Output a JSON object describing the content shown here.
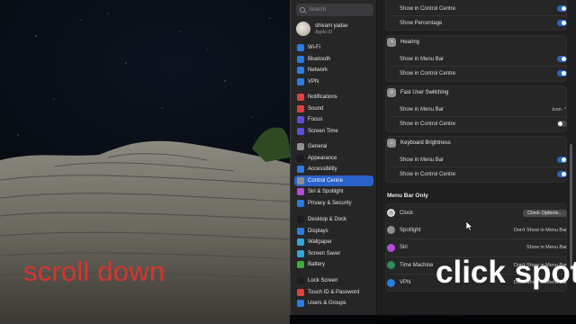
{
  "overlay": {
    "scroll_text": "scroll down",
    "click_text": "click spot"
  },
  "search": {
    "placeholder": "Search"
  },
  "account": {
    "name": "shivam yadav",
    "sub": "Apple ID"
  },
  "sidebar": {
    "network": [
      {
        "label": "Wi-Fi",
        "icon": "wifi-icon",
        "color": "#2a7de1"
      },
      {
        "label": "Bluetooth",
        "icon": "bluetooth-icon",
        "color": "#2a7de1"
      },
      {
        "label": "Network",
        "icon": "network-icon",
        "color": "#2a7de1"
      },
      {
        "label": "VPN",
        "icon": "vpn-icon",
        "color": "#2a7de1"
      }
    ],
    "notify": [
      {
        "label": "Notifications",
        "icon": "notifications-icon",
        "color": "#e0413c"
      },
      {
        "label": "Sound",
        "icon": "sound-icon",
        "color": "#e0413c"
      },
      {
        "label": "Focus",
        "icon": "focus-icon",
        "color": "#5b4fd6"
      },
      {
        "label": "Screen Time",
        "icon": "screen-time-icon",
        "color": "#5b4fd6"
      }
    ],
    "general": [
      {
        "label": "General",
        "icon": "gear-icon",
        "color": "#8e8e93"
      },
      {
        "label": "Appearance",
        "icon": "appearance-icon",
        "color": "#1c1c1e"
      },
      {
        "label": "Accessibility",
        "icon": "accessibility-icon",
        "color": "#2a7de1"
      },
      {
        "label": "Control Centre",
        "icon": "control-centre-icon",
        "color": "#8e8e93",
        "active": true
      },
      {
        "label": "Siri & Spotlight",
        "icon": "siri-icon",
        "color": "#b44ad6"
      },
      {
        "label": "Privacy & Security",
        "icon": "privacy-icon",
        "color": "#2a7de1"
      }
    ],
    "display": [
      {
        "label": "Desktop & Dock",
        "icon": "dock-icon",
        "color": "#1c1c1e"
      },
      {
        "label": "Displays",
        "icon": "displays-icon",
        "color": "#2a7de1"
      },
      {
        "label": "Wallpaper",
        "icon": "wallpaper-icon",
        "color": "#35a7d8"
      },
      {
        "label": "Screen Saver",
        "icon": "screen-saver-icon",
        "color": "#35a7d8"
      },
      {
        "label": "Battery",
        "icon": "battery-icon",
        "color": "#3fae3f"
      }
    ],
    "security": [
      {
        "label": "Lock Screen",
        "icon": "lock-icon",
        "color": "#1c1c1e"
      },
      {
        "label": "Touch ID & Password",
        "icon": "touch-id-icon",
        "color": "#e0413c"
      },
      {
        "label": "Users & Groups",
        "icon": "users-icon",
        "color": "#2a7de1"
      }
    ]
  },
  "content": {
    "battery_rows": [
      {
        "label": "Show in Control Centre",
        "on": true
      },
      {
        "label": "Show Percentage",
        "on": true
      }
    ],
    "hearing": {
      "title": "Hearing",
      "rows": [
        {
          "label": "Show in Menu Bar",
          "on": true
        },
        {
          "label": "Show in Control Centre",
          "on": true
        }
      ]
    },
    "fast_user": {
      "title": "Fast User Switching",
      "menu_label": "Show in Menu Bar",
      "menu_value": "Icon",
      "cc_label": "Show in Control Centre",
      "cc_on": false
    },
    "keyboard": {
      "title": "Keyboard Brightness",
      "rows": [
        {
          "label": "Show in Menu Bar",
          "on": true
        },
        {
          "label": "Show in Control Centre",
          "on": true
        }
      ]
    },
    "menu_bar_only": {
      "title": "Menu Bar Only",
      "clock": {
        "label": "Clock",
        "button": "Clock Options..."
      },
      "items": [
        {
          "label": "Spotlight",
          "value": "Don't Show in Menu Bar",
          "icon": "spotlight-icon",
          "color": "#8e8e93"
        },
        {
          "label": "Siri",
          "value": "Show in Menu Bar",
          "icon": "siri-icon",
          "color": "#b44ad6"
        },
        {
          "label": "Time Machine",
          "value": "Don't Show in Menu Bar",
          "icon": "time-machine-icon",
          "color": "#2e8b57"
        },
        {
          "label": "VPN",
          "value": "Don't Show in Menu Bar",
          "icon": "vpn-icon",
          "color": "#2a7de1"
        }
      ]
    },
    "help": "?"
  }
}
